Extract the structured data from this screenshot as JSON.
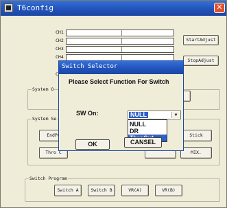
{
  "window": {
    "title": "T6config"
  },
  "channels": [
    "CH1",
    "CH2",
    "CH3",
    "CH4",
    "C"
  ],
  "main_buttons": {
    "start_adjust": "StartAdjust",
    "stop_adjust": "StopAdjust"
  },
  "groups": {
    "system_o": "System O",
    "system_s": "System Se",
    "switch_program": "Switch Program"
  },
  "system_buttons": {
    "endpo": "EndPo",
    "thro": "Thro C",
    "stick": "Stick",
    "mix": "MIX."
  },
  "switch_buttons": [
    "Switch A",
    "Switch B",
    "VR(A)",
    "VR(B)"
  ],
  "dialog": {
    "title": "Switch Selector",
    "message": "Please Select Function For Switch",
    "sw_label": "SW On:",
    "selected": "NULL",
    "options": [
      "NULL",
      "DR",
      "ThroCut"
    ],
    "highlighted_option": "ThroCut",
    "ok": "OK",
    "cancel": "CANSEL"
  },
  "colors": {
    "titlebar": "#2152b8",
    "highlight": "#2f5fc8",
    "background": "#efecd8"
  }
}
